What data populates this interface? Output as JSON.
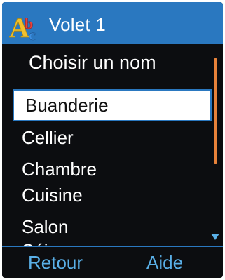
{
  "titlebar": {
    "title": "Volet 1",
    "icon": "abc-letters-icon"
  },
  "prompt": "Choisir un nom",
  "list": {
    "items": [
      {
        "label": "Buanderie",
        "selected": true
      },
      {
        "label": "Cellier"
      },
      {
        "label": "Chambre"
      },
      {
        "label": "Cuisine"
      },
      {
        "label": "Salon"
      },
      {
        "label": "Séjour"
      }
    ]
  },
  "softkeys": {
    "left": "Retour",
    "right": "Aide"
  },
  "colors": {
    "background": "#0c0d10",
    "titlebar": "#2a78c0",
    "accent": "#5ab0e8",
    "scrollbar": "#e8823a"
  }
}
